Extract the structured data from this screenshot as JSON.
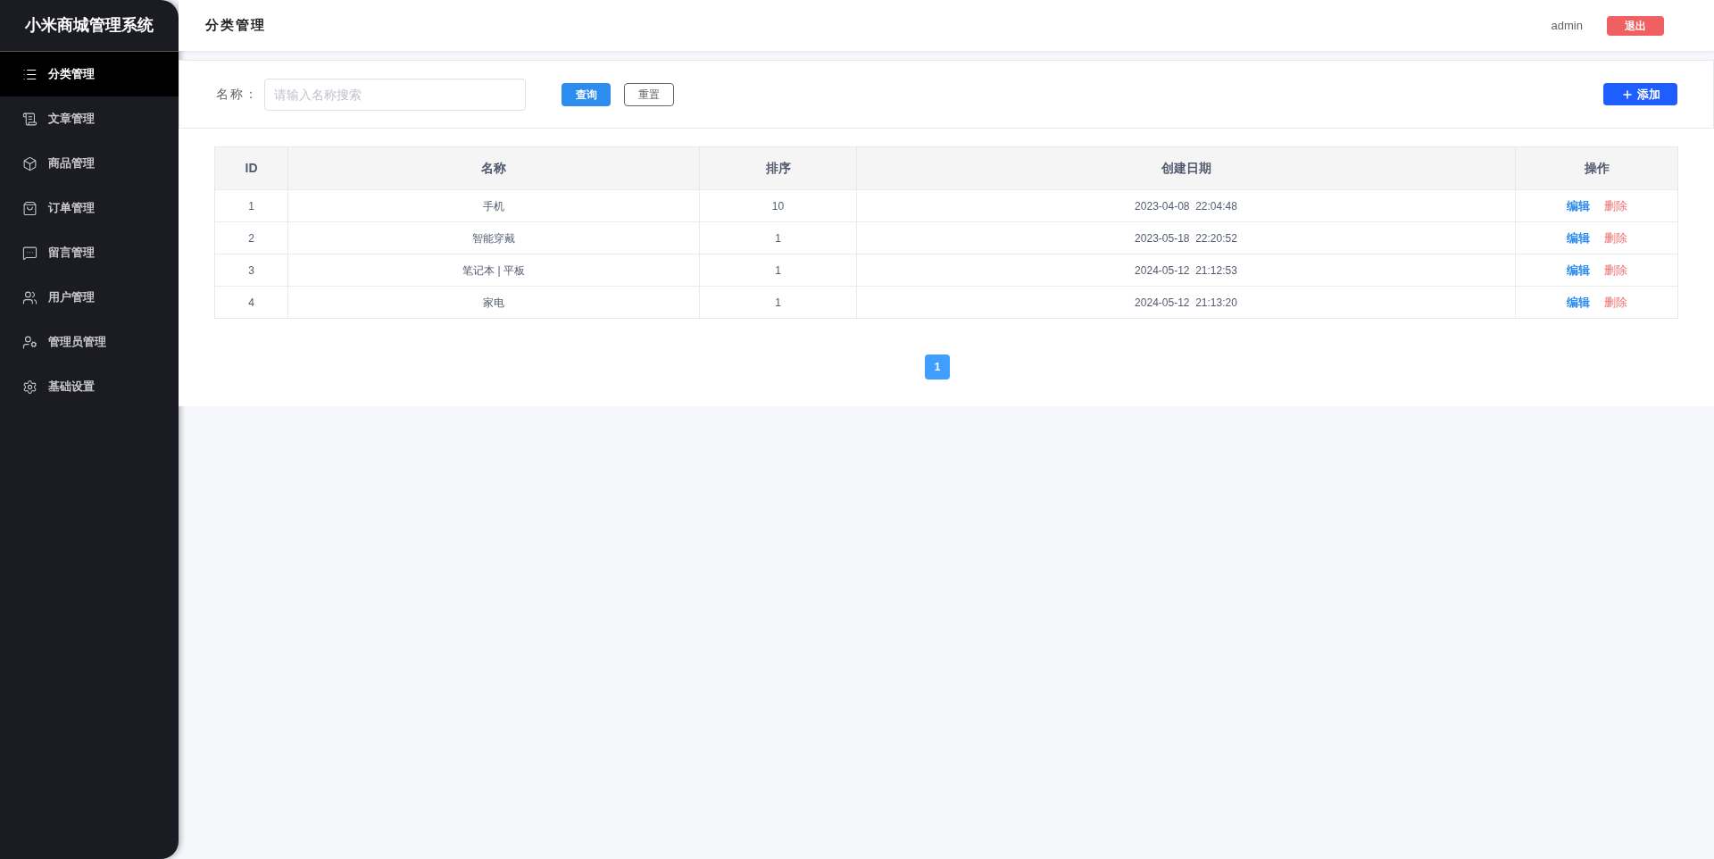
{
  "sidebar": {
    "title": "小米商城管理系统",
    "items": [
      {
        "label": "分类管理",
        "selected": true
      },
      {
        "label": "文章管理",
        "selected": false
      },
      {
        "label": "商品管理",
        "selected": false
      },
      {
        "label": "订单管理",
        "selected": false
      },
      {
        "label": "留言管理",
        "selected": false
      },
      {
        "label": "用户管理",
        "selected": false
      },
      {
        "label": "管理员管理",
        "selected": false
      },
      {
        "label": "基础设置",
        "selected": false
      }
    ]
  },
  "header": {
    "title": "分类管理",
    "user": "admin",
    "logout": "退出"
  },
  "search": {
    "label": "名称：",
    "placeholder": "请输入名称搜索",
    "query_button": "查询",
    "reset_button": "重置",
    "add_button": "添加"
  },
  "table": {
    "columns": [
      "ID",
      "名称",
      "排序",
      "创建日期",
      "操作"
    ],
    "rows": [
      {
        "id": "1",
        "name": "手机",
        "sort": "10",
        "created": "2023-04-08  22:04:48",
        "edit": "编辑",
        "delete": "删除"
      },
      {
        "id": "2",
        "name": "智能穿戴",
        "sort": "1",
        "created": "2023-05-18  22:20:52",
        "edit": "编辑",
        "delete": "删除"
      },
      {
        "id": "3",
        "name": "笔记本 | 平板",
        "sort": "1",
        "created": "2024-05-12  21:12:53",
        "edit": "编辑",
        "delete": "删除"
      },
      {
        "id": "4",
        "name": "家电",
        "sort": "1",
        "created": "2024-05-12  21:13:20",
        "edit": "编辑",
        "delete": "删除"
      }
    ]
  },
  "pagination": {
    "pages": [
      {
        "label": "1",
        "selected": true
      }
    ]
  }
}
